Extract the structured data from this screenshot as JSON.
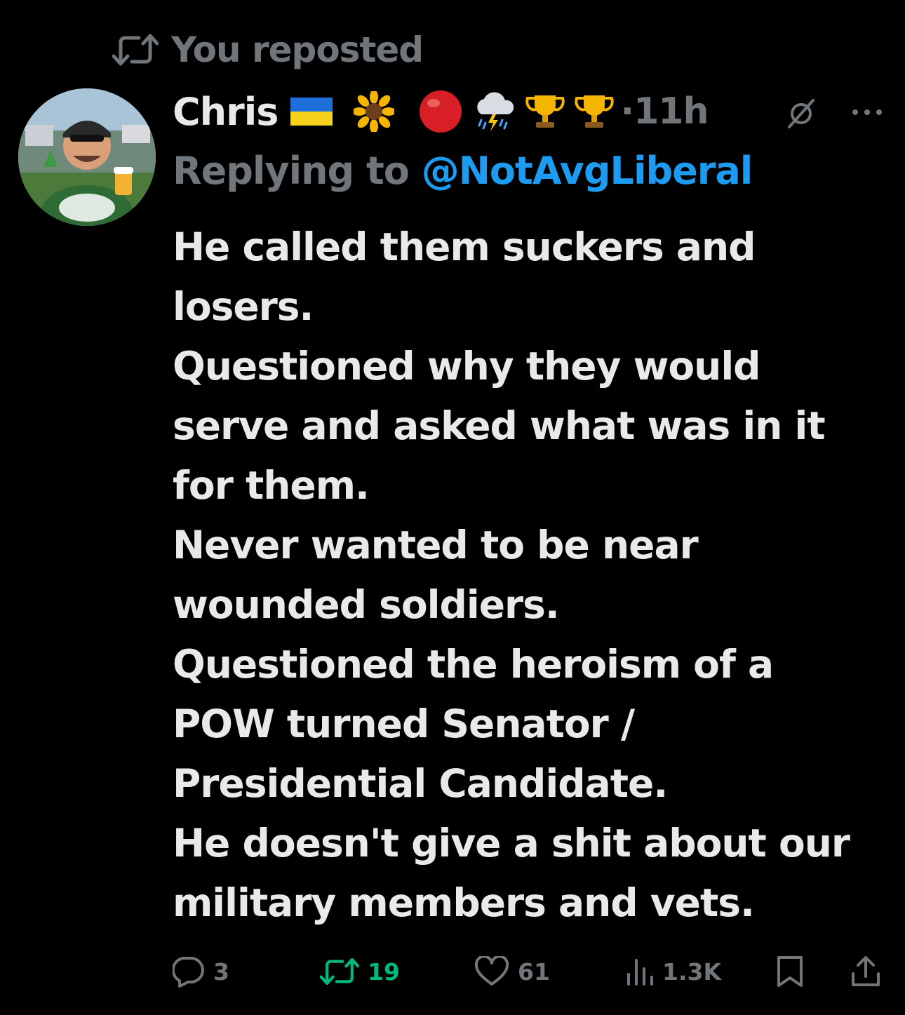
{
  "repost_banner": {
    "icon": "repost-icon",
    "text": "You reposted"
  },
  "post": {
    "author_name": "Chris",
    "name_emojis": [
      {
        "name": "ukraine-flag-icon"
      },
      {
        "name": "sunflower-icon"
      },
      {
        "name": "red-circle-icon"
      },
      {
        "name": "cloud-rain-lightning-icon"
      },
      {
        "name": "trophy-icon"
      },
      {
        "name": "trophy-icon"
      }
    ],
    "time": "11h",
    "reply_prefix": "Replying to ",
    "reply_handle": "@NotAvgLiberal",
    "body_lines": [
      "He called them suckers and",
      "losers.",
      "Questioned why they would",
      "serve and asked what was in it",
      "for them.",
      "Never wanted to be near",
      "wounded soldiers.",
      "Questioned the heroism of a",
      "POW turned Senator /",
      "Presidential Candidate.",
      "He doesn't give a shit about our",
      "military members and vets."
    ]
  },
  "actions": {
    "replies": "3",
    "reposts": "19",
    "likes": "61",
    "views": "1.3K"
  },
  "colors": {
    "background": "#000000",
    "primary_text": "#e7e9ea",
    "secondary_text": "#71767b",
    "link": "#1d9bf0",
    "repost_active": "#00ba7c"
  }
}
